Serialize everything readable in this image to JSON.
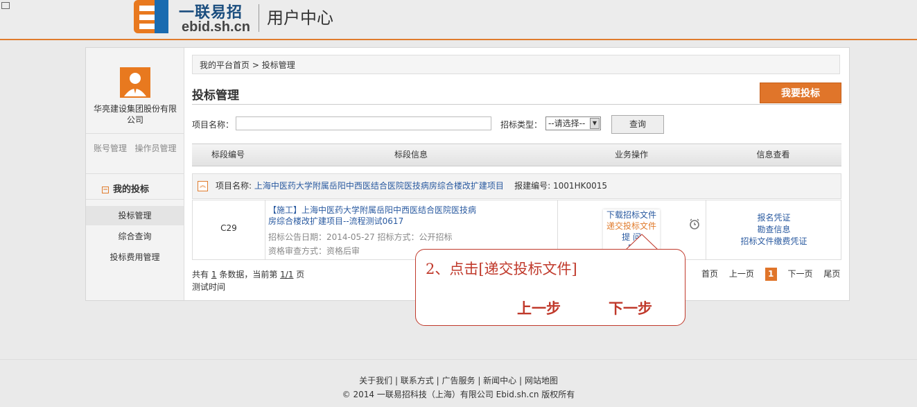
{
  "header": {
    "logo_text": "一联易招",
    "logo_domain": "ebid.sh.cn",
    "title": "用户中心"
  },
  "sidebar": {
    "company": "华亮建设集团股份有限公司",
    "account_manage": "账号管理",
    "operator_manage": "操作员管理",
    "section_title": "我的投标",
    "items": [
      {
        "label": "投标管理",
        "active": true
      },
      {
        "label": "综合查询",
        "active": false
      },
      {
        "label": "投标费用管理",
        "active": false
      }
    ]
  },
  "breadcrumb": {
    "home": "我的平台首页",
    "separator": ">",
    "current": "投标管理"
  },
  "page_title": "投标管理",
  "bid_button": "我要投标",
  "search": {
    "project_label": "项目名称：",
    "project_value": "",
    "type_label": "招标类型：",
    "type_selected": "--请选择--",
    "query_button": "查询"
  },
  "table": {
    "headers": [
      "标段编号",
      "标段信息",
      "业务操作",
      "信息查看"
    ],
    "project": {
      "name_label": "项目名称:",
      "name": "上海中医药大学附属岳阳中西医结合医院医技病房综合楼改扩建项目",
      "code_label": "报建编号:",
      "code": "1001HK0015"
    },
    "row": {
      "code": "C29",
      "title": "【施工】上海中医药大学附属岳阳中西医结合医院医技病房综合楼改扩建项目--流程测试0617",
      "date": "招标公告日期：2014-05-27   招标方式：公开招标",
      "review": "资格审查方式：资格后审",
      "ops": [
        "下载招标文件",
        "递交投标文件",
        "提  问",
        "日"
      ],
      "info": [
        "报名凭证",
        "勘查信息",
        "招标文件缴费凭证"
      ]
    }
  },
  "pagination": {
    "summary_prefix": "共有",
    "total": "1",
    "summary_mid": "条数据，当前第",
    "page": "1/1",
    "summary_suffix": "页",
    "test_time": "测试时间",
    "first": "首页",
    "prev": "上一页",
    "current": "1",
    "next": "下一页",
    "last": "尾页"
  },
  "callout": {
    "text": "2、点击[递交投标文件]",
    "prev": "上一步",
    "next": "下一步"
  },
  "footer": {
    "links": [
      "关于我们",
      "联系方式",
      "广告服务",
      "新闻中心",
      "网站地图"
    ],
    "copyright": "© 2014 一联易招科技（上海）有限公司 Ebid.sh.cn 版权所有"
  },
  "colors": {
    "accent": "#e0752a",
    "link": "#2a5aa0",
    "callout": "#c0392b"
  }
}
